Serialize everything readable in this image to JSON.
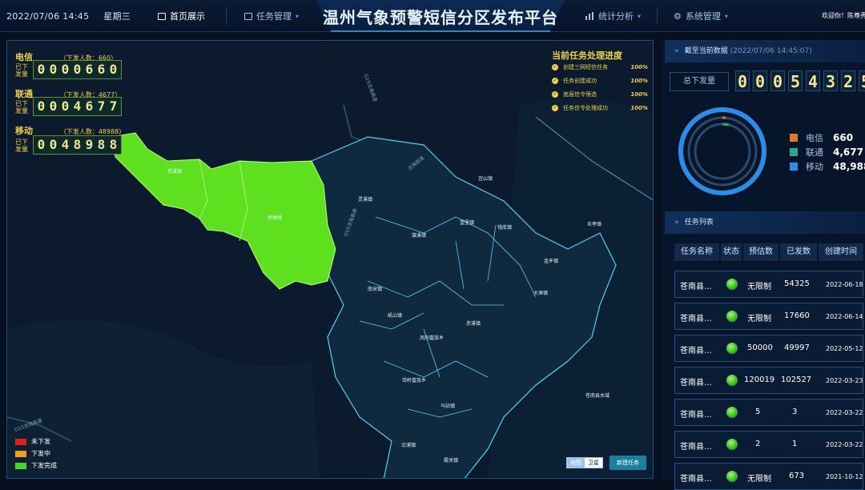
{
  "header": {
    "datetime": "2022/07/06 14:45",
    "weekday": "星期三",
    "title": "温州气象预警短信分区发布平台",
    "welcome": "欢迎你！陈尊秀",
    "nav": [
      {
        "label": "首页展示",
        "icon": "monitor-icon",
        "active": true
      },
      {
        "label": "任务管理",
        "icon": "task-icon",
        "active": false
      },
      {
        "label": "统计分析",
        "icon": "bar-chart-icon",
        "active": false
      },
      {
        "label": "系统管理",
        "icon": "gear-icon",
        "active": false
      }
    ]
  },
  "map_panel": {
    "carriers": [
      {
        "name": "电信",
        "count_label": "（下发人数：660）",
        "sent_label": "已下发量",
        "digits": [
          "0",
          "0",
          "0",
          "0",
          "6",
          "6",
          "0"
        ]
      },
      {
        "name": "联通",
        "count_label": "（下发人数：4677）",
        "sent_label": "已下发量",
        "digits": [
          "0",
          "0",
          "0",
          "4",
          "6",
          "7",
          "7"
        ]
      },
      {
        "name": "移动",
        "count_label": "（下发人数：48988）",
        "sent_label": "已下发量",
        "digits": [
          "0",
          "0",
          "4",
          "8",
          "9",
          "8",
          "8"
        ]
      }
    ],
    "progress": {
      "title": "当前任务处理进度",
      "items": [
        {
          "label": "创建三网短信任务",
          "pct": "100%"
        },
        {
          "label": "任务创建成功",
          "pct": "100%"
        },
        {
          "label": "底层信令筛选",
          "pct": "100%"
        },
        {
          "label": "任务信令处理成功",
          "pct": "100%"
        }
      ]
    },
    "towns": [
      "莒溪镇",
      "桥墩镇",
      "灵溪镇",
      "藻溪镇",
      "望里镇",
      "钱库镇",
      "金乡镇",
      "矾山镇",
      "南宋镇",
      "赤溪镇",
      "凤阳畲族乡",
      "大渔镇",
      "岱岭畲族乡",
      "马站镇",
      "沿浦镇",
      "霞关镇",
      "苍南县水域",
      "炎亭镇",
      "宜山镇"
    ],
    "roads": [
      "G15沈海高速",
      "沈海高速",
      "G15沈海高速",
      "G15沈海高速"
    ],
    "legend": [
      {
        "label": "未下发",
        "color": "#e02020"
      },
      {
        "label": "下发中",
        "color": "#f0a020"
      },
      {
        "label": "下发完成",
        "color": "#4bd42a"
      }
    ],
    "map_toggle": [
      "地图",
      "卫星"
    ],
    "new_task_label": "新建任务",
    "completed_color": "#5ee01e"
  },
  "stats": {
    "head_title": "截至当前数据",
    "head_time": "(2022/07/06 14:45:07)",
    "total_label": "总下发量",
    "total_digits": [
      "0",
      "0",
      "0",
      "5",
      "4",
      "3",
      "2",
      "5"
    ],
    "legend": [
      {
        "name": "电信",
        "value": "660",
        "color": "#e0782a"
      },
      {
        "name": "联通",
        "value": "4,677",
        "color": "#2aa889"
      },
      {
        "name": "移动",
        "value": "48,988",
        "color": "#2a8ee8"
      }
    ]
  },
  "tasks": {
    "head_title": "任务列表",
    "columns": [
      "任务名称",
      "状态",
      "预估数",
      "已发数",
      "创建时间"
    ],
    "rows": [
      {
        "name": "苍南县...",
        "estimate": "无限制",
        "sent": "54325",
        "created": "2022-06-18"
      },
      {
        "name": "苍南县...",
        "estimate": "无限制",
        "sent": "17660",
        "created": "2022-06-14"
      },
      {
        "name": "苍南县...",
        "estimate": "50000",
        "sent": "49997",
        "created": "2022-05-12"
      },
      {
        "name": "苍南县...",
        "estimate": "120019",
        "sent": "102527",
        "created": "2022-03-23"
      },
      {
        "name": "苍南县...",
        "estimate": "5",
        "sent": "3",
        "created": "2022-03-22"
      },
      {
        "name": "苍南县...",
        "estimate": "2",
        "sent": "1",
        "created": "2022-03-22"
      },
      {
        "name": "苍南县...",
        "estimate": "无限制",
        "sent": "673",
        "created": "2021-10-12"
      }
    ]
  }
}
